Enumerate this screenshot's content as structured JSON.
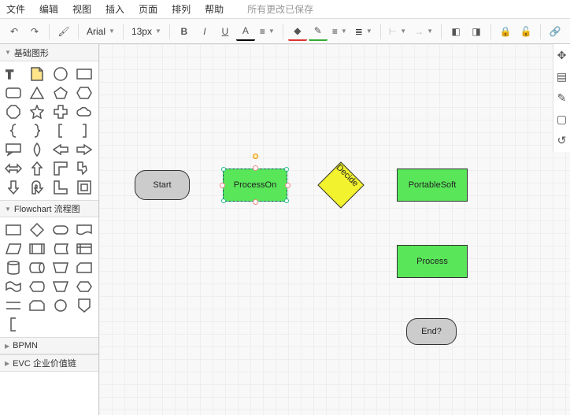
{
  "menu": {
    "file": "文件",
    "edit": "编辑",
    "view": "视图",
    "insert": "插入",
    "page": "页面",
    "arrange": "排列",
    "help": "帮助",
    "saved": "所有更改已保存"
  },
  "toolbar": {
    "font": "Arial",
    "size": "13px",
    "bold": "B",
    "italic": "I",
    "underline": "U",
    "fontcolor": "A",
    "linkicon": "🔗"
  },
  "sidebar": {
    "basic": "基础图形",
    "flow": "Flowchart 流程图",
    "bpmn": "BPMN",
    "evc": "EVC 企业价值链"
  },
  "nodes": {
    "start": "Start",
    "processon": "ProcessOn",
    "decide": "Decide",
    "portable": "PortableSoft",
    "process": "Process",
    "end": "End?"
  }
}
